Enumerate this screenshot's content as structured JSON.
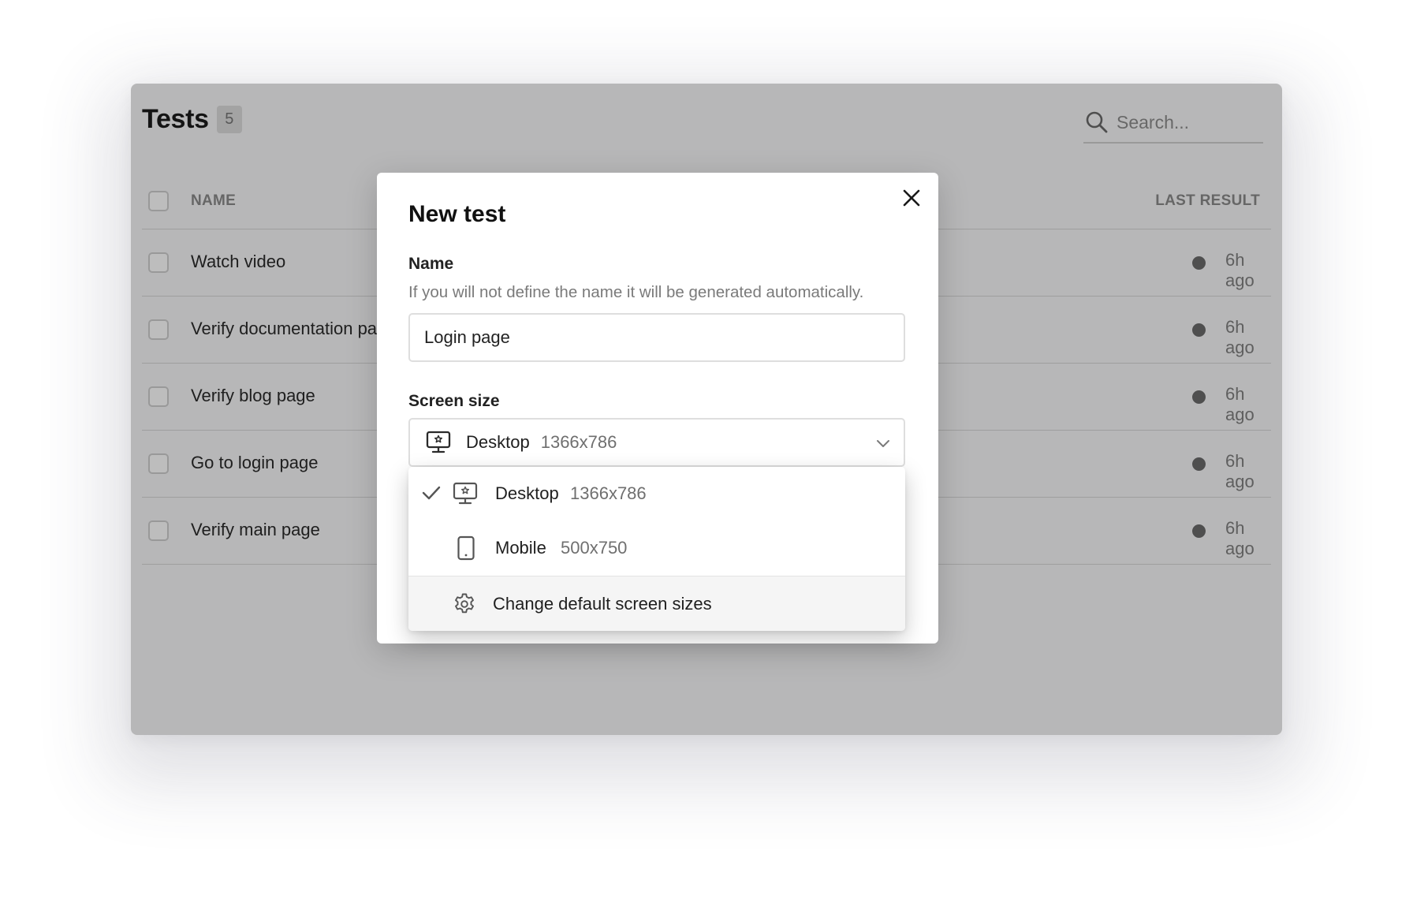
{
  "page": {
    "title": "Tests",
    "count": "5",
    "search": {
      "placeholder": "Search..."
    }
  },
  "table": {
    "columns": {
      "name": "NAME",
      "last_result": "LAST RESULT"
    },
    "rows": [
      {
        "name": "Watch video",
        "time": "6h ago"
      },
      {
        "name": "Verify documentation page",
        "time": "6h ago"
      },
      {
        "name": "Verify blog page",
        "time": "6h ago"
      },
      {
        "name": "Go to login page",
        "time": "6h ago"
      },
      {
        "name": "Verify main page",
        "time": "6h ago"
      }
    ]
  },
  "modal": {
    "title": "New test",
    "name_label": "Name",
    "name_help": "If you will not define the name it will be generated automatically.",
    "name_value": "Login page",
    "screen_size_label": "Screen size",
    "selected": {
      "label": "Desktop",
      "size": "1366x786",
      "icon": "desktop-icon"
    },
    "options": [
      {
        "label": "Desktop",
        "size": "1366x786",
        "icon": "desktop-icon",
        "selected": true
      },
      {
        "label": "Mobile",
        "size": "500x750",
        "icon": "mobile-icon",
        "selected": false
      }
    ],
    "settings_label": "Change default screen sizes",
    "settings_icon": "gear-icon"
  }
}
